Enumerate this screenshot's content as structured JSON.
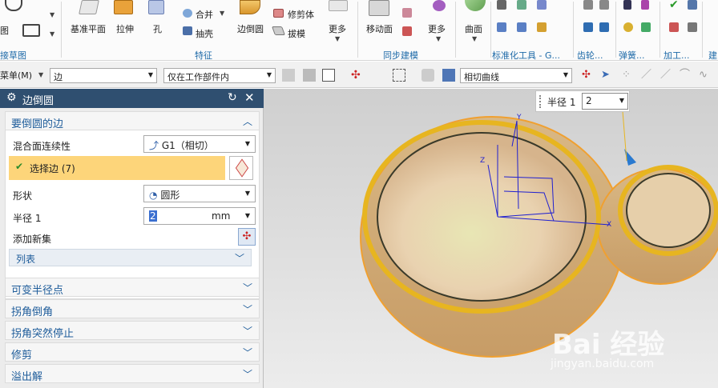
{
  "ribbon": {
    "left_partial": [
      "图",
      "接草图"
    ],
    "features": {
      "buttons": [
        "基准平面",
        "拉伸",
        "孔",
        "合并",
        "抽壳",
        "边倒圆",
        "修剪体",
        "拔模",
        "更多"
      ],
      "label": "特征"
    },
    "sync": {
      "buttons": [
        "移动面",
        "更多"
      ],
      "label": "同步建模"
    },
    "surface": {
      "buttons": [
        "曲面"
      ]
    },
    "std_tools": {
      "label": "标准化工具 - G..."
    },
    "gear": {
      "label": "齿轮..."
    },
    "spring": {
      "label": "弹簧..."
    },
    "machining": {
      "label": "加工..."
    },
    "build": {
      "label": "建"
    }
  },
  "selection_bar": {
    "menu": "菜单(M)",
    "filter": "边",
    "scope": "仅在工作部件内",
    "curve_rule": "相切曲线"
  },
  "dialog": {
    "title": "边倒圆",
    "edges_section": "要倒圆的边",
    "blend_continuity_label": "混合面连续性",
    "blend_continuity_value": "G1（相切）",
    "select_edge_label": "选择边 (7)",
    "shape_label": "形状",
    "shape_value": "圆形",
    "radius_label": "半径 1",
    "radius_value": "2",
    "radius_unit": "mm",
    "add_new_set": "添加新集",
    "list_label": "列表",
    "collapsed_sections": [
      "可变半径点",
      "拐角倒角",
      "拐角突然停止",
      "修剪",
      "溢出解"
    ]
  },
  "viewport": {
    "radius_popup_label": "半径 1",
    "radius_popup_value": "2",
    "axes": [
      "X",
      "Y",
      "Z"
    ],
    "watermark": "Bai 经验",
    "watermark_url": "jingyan.baidu.com"
  },
  "colors": {
    "title_bar": "#2f4f70",
    "section_text": "#1e5c9a",
    "selection_highlight": "#fdd57a",
    "model_edge": "#f0a030",
    "axis": "#2020d0"
  }
}
